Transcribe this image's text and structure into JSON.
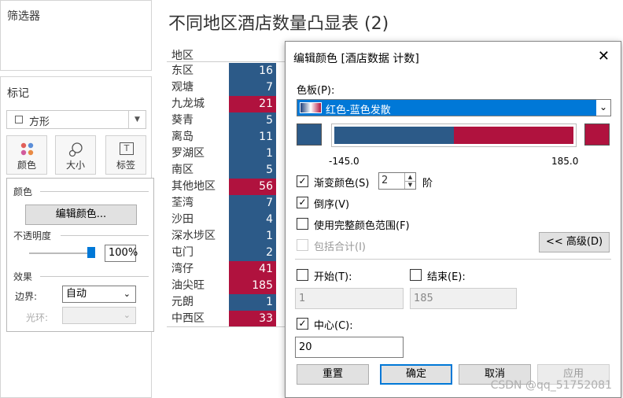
{
  "sidebar": {
    "filters_title": "筛选器",
    "marks_title": "标记",
    "mark_type": "方形",
    "cards": [
      "颜色",
      "大小",
      "标签"
    ],
    "popover": {
      "color_header": "颜色",
      "edit_color_button": "编辑颜色...",
      "opacity_header": "不透明度",
      "opacity_value": "100%",
      "opacity_level": 1.0,
      "effects_header": "效果",
      "border_label": "边界:",
      "border_value": "自动",
      "halo_label": "光环:",
      "halo_value": ""
    }
  },
  "table": {
    "title": "不同地区酒店数量凸显表 (2)",
    "header": "地区",
    "colors": {
      "blue": "#2c5a88",
      "red": "#b0123e"
    },
    "rows": [
      {
        "label": "东区",
        "value": "16",
        "color": "blue"
      },
      {
        "label": "观塘",
        "value": "7",
        "color": "blue"
      },
      {
        "label": "九龙城",
        "value": "21",
        "color": "red"
      },
      {
        "label": "葵青",
        "value": "5",
        "color": "blue"
      },
      {
        "label": "离岛",
        "value": "11",
        "color": "blue"
      },
      {
        "label": "罗湖区",
        "value": "1",
        "color": "blue"
      },
      {
        "label": "南区",
        "value": "5",
        "color": "blue"
      },
      {
        "label": "其他地区",
        "value": "56",
        "color": "red"
      },
      {
        "label": "荃湾",
        "value": "7",
        "color": "blue"
      },
      {
        "label": "沙田",
        "value": "4",
        "color": "blue"
      },
      {
        "label": "深水埗区",
        "value": "1",
        "color": "blue"
      },
      {
        "label": "屯门",
        "value": "2",
        "color": "blue"
      },
      {
        "label": "湾仔",
        "value": "41",
        "color": "red"
      },
      {
        "label": "油尖旺",
        "value": "185",
        "color": "red"
      },
      {
        "label": "元朗",
        "value": "1",
        "color": "blue"
      },
      {
        "label": "中西区",
        "value": "33",
        "color": "red"
      }
    ]
  },
  "dialog": {
    "title": "编辑颜色 [酒店数据 计数]",
    "palette_label": "色板(P):",
    "palette_value": "红色-蓝色发散",
    "range_min": "-145.0",
    "range_max": "185.0",
    "blue_fraction": 0.5,
    "stepped_label": "渐变颜色(S)",
    "stepped_value": "2",
    "stepped_unit": "阶",
    "reversed_label": "倒序(V)",
    "full_range_label": "使用完整颜色范围(F)",
    "include_totals_label": "包括合计(I)",
    "advanced_button": "<< 高级(D)",
    "start_label": "开始(T):",
    "end_label": "结束(E):",
    "start_value": "1",
    "end_value": "185",
    "center_label": "中心(C):",
    "center_value": "20",
    "reset_button": "重置",
    "ok_button": "确定",
    "cancel_button": "取消",
    "apply_button": "应用",
    "check_mark": "✓",
    "colors": {
      "blue": "#2c5a88",
      "red": "#b0123e",
      "accent": "#0078d7"
    }
  },
  "watermark": "CSDN @qq_51752081"
}
